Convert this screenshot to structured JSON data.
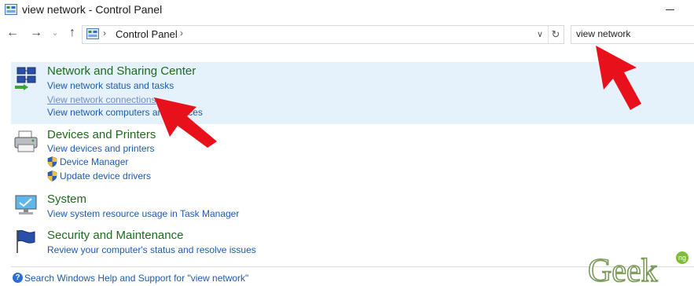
{
  "window": {
    "title": "view network - Control Panel"
  },
  "toolbar": {
    "back_glyph": "←",
    "forward_glyph": "→",
    "recent_glyph": "⌄",
    "up_glyph": "↑",
    "breadcrumb": [
      "Control Panel"
    ],
    "separator": "›",
    "dropdown_glyph": "∨",
    "refresh_glyph": "↻"
  },
  "search": {
    "value": "view network"
  },
  "sections": {
    "network": {
      "title": "Network and Sharing Center",
      "links": [
        "View network status and tasks",
        "View network connections",
        "View network computers and devices"
      ]
    },
    "devices": {
      "title": "Devices and Printers",
      "links": [
        "View devices and printers",
        "Device Manager",
        "Update device drivers"
      ]
    },
    "system": {
      "title": "System",
      "links": [
        "View system resource usage in Task Manager"
      ]
    },
    "security": {
      "title": "Security and Maintenance",
      "links": [
        "Review your computer's status and resolve issues"
      ]
    }
  },
  "footer": {
    "help_link": "Search Windows Help and Support for \"view network\""
  },
  "watermark": {
    "text": "Geek",
    "badge": "ng"
  },
  "colors": {
    "highlight": "#e5f1fb",
    "title_green": "#1e6b1e",
    "link_blue": "#1e5bb0",
    "arrow_red": "#e8101a"
  },
  "icons": [
    "control-panel-icon",
    "network-center-icon",
    "printer-icon",
    "monitor-icon",
    "flag-icon",
    "shield-icon",
    "help-icon"
  ]
}
